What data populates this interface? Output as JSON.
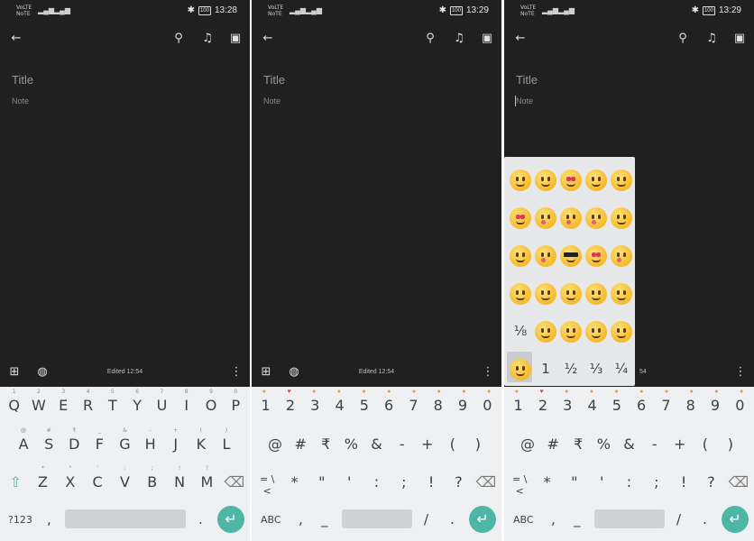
{
  "status": {
    "net_top": "VoLTE",
    "net_bottom": "NoTE",
    "battery": "100",
    "clock_1": "13:28",
    "clock_2": "13:29",
    "clock_3": "13:29"
  },
  "note": {
    "title_placeholder": "Title",
    "note_placeholder": "Note",
    "edited": "Edited 12:54"
  },
  "toolbar_icons": [
    "back-arrow-icon",
    "pin-icon",
    "reminder-bell-icon",
    "archive-icon"
  ],
  "bottom_icons": [
    "add-box-icon",
    "palette-icon",
    "more-vert-icon"
  ],
  "keyboard1": {
    "row1": [
      "Q",
      "W",
      "E",
      "R",
      "T",
      "Y",
      "U",
      "I",
      "O",
      "P"
    ],
    "row1_sup": [
      "1",
      "2",
      "3",
      "4",
      "5",
      "6",
      "7",
      "8",
      "9",
      "0"
    ],
    "row2": [
      "A",
      "S",
      "D",
      "F",
      "G",
      "H",
      "J",
      "K",
      "L"
    ],
    "row2_sup": [
      "@",
      "#",
      "₹",
      "_",
      "&",
      "-",
      "+",
      "(",
      ")"
    ],
    "row3": [
      "Z",
      "X",
      "C",
      "V",
      "B",
      "N",
      "M"
    ],
    "row3_sup": [
      "*",
      "\"",
      "'",
      ":",
      ";",
      "!",
      "?"
    ],
    "mode_key": "?123",
    "comma": ","
  },
  "keyboard2": {
    "row1": [
      "1",
      "2",
      "3",
      "4",
      "5",
      "6",
      "7",
      "8",
      "9",
      "0"
    ],
    "row2": [
      "@",
      "#",
      "₹",
      "%",
      "&",
      "-",
      "+",
      "(",
      ")"
    ],
    "row3": [
      "*",
      "\"",
      "'",
      ":",
      ";",
      "!",
      "?"
    ],
    "more_key": "= \\ <",
    "mode_key": "ABC",
    "comma": ",",
    "underscore": "_",
    "slash": "/"
  },
  "emoji_panel": {
    "fractions": [
      "⅛",
      "1",
      "½",
      "⅓",
      "¼"
    ]
  },
  "colors": {
    "bg": "#202020",
    "keyboard": "#eef0f2",
    "enter": "#4db6a4"
  }
}
